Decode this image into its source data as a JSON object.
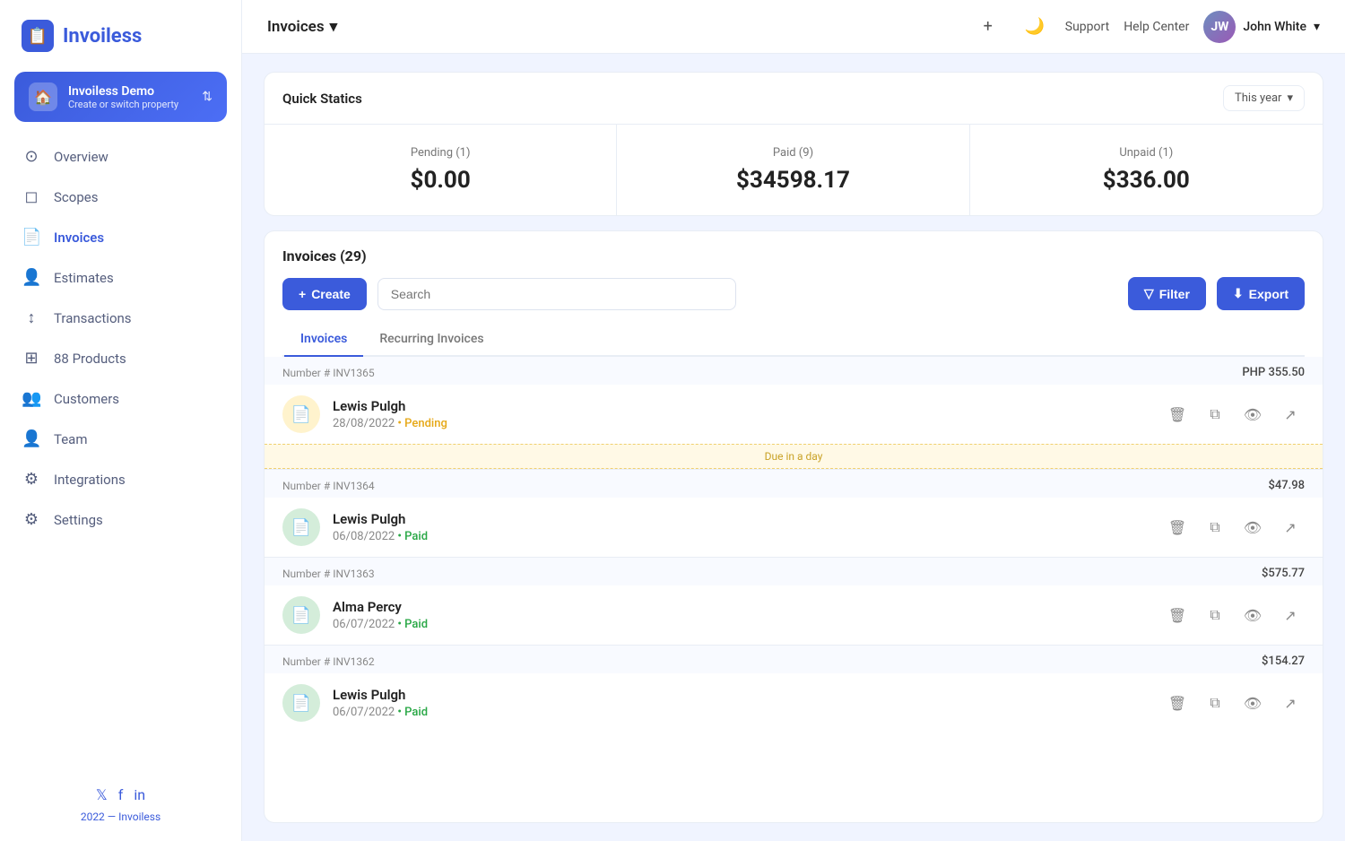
{
  "sidebar": {
    "logo_text": "Invoiless",
    "property": {
      "name": "Invoiless Demo",
      "sub": "Create or switch property",
      "icon": "🏠"
    },
    "nav_items": [
      {
        "id": "overview",
        "label": "Overview",
        "icon": "⊙"
      },
      {
        "id": "scopes",
        "label": "Scopes",
        "icon": "◻"
      },
      {
        "id": "invoices",
        "label": "Invoices",
        "icon": "📄"
      },
      {
        "id": "estimates",
        "label": "Estimates",
        "icon": "👤"
      },
      {
        "id": "transactions",
        "label": "Transactions",
        "icon": "↕"
      },
      {
        "id": "products",
        "label": "88 Products",
        "icon": "⊞"
      },
      {
        "id": "customers",
        "label": "Customers",
        "icon": "👥"
      },
      {
        "id": "team",
        "label": "Team",
        "icon": "👤"
      },
      {
        "id": "integrations",
        "label": "Integrations",
        "icon": "⚙"
      },
      {
        "id": "settings",
        "label": "Settings",
        "icon": "⚙"
      }
    ],
    "footer": {
      "social": [
        "𝕏",
        "f",
        "in"
      ],
      "text": "2022 — Invoiless"
    }
  },
  "topbar": {
    "title": "Invoices",
    "title_chevron": "▾",
    "add_icon": "+",
    "theme_icon": "🌙",
    "support_label": "Support",
    "help_label": "Help Center",
    "user_name": "John White",
    "user_chevron": "▾"
  },
  "quick_stats": {
    "title": "Quick Statics",
    "year_selector": "This year",
    "year_chevron": "▾",
    "stats": [
      {
        "label": "Pending (1)",
        "value": "$0.00"
      },
      {
        "label": "Paid (9)",
        "value": "$34598.17"
      },
      {
        "label": "Unpaid (1)",
        "value": "$336.00"
      }
    ]
  },
  "invoices_section": {
    "title": "Invoices (29)",
    "search_placeholder": "Search",
    "create_label": "+ Create",
    "filter_label": "Filter",
    "export_label": "Export",
    "tabs": [
      {
        "id": "invoices",
        "label": "Invoices",
        "active": true
      },
      {
        "id": "recurring",
        "label": "Recurring Invoices",
        "active": false
      }
    ],
    "invoices": [
      {
        "number": "Number # INV1365",
        "amount": "PHP 355.50",
        "name": "Lewis Pulgh",
        "date": "28/08/2022",
        "status": "Pending",
        "status_type": "pending",
        "due_notice": "Due in a day"
      },
      {
        "number": "Number # INV1364",
        "amount": "$47.98",
        "name": "Lewis Pulgh",
        "date": "06/08/2022",
        "status": "Paid",
        "status_type": "paid",
        "due_notice": null
      },
      {
        "number": "Number # INV1363",
        "amount": "$575.77",
        "name": "Alma Percy",
        "date": "06/07/2022",
        "status": "Paid",
        "status_type": "paid",
        "due_notice": null
      },
      {
        "number": "Number # INV1362",
        "amount": "$154.27",
        "name": "Lewis Pulgh",
        "date": "06/07/2022",
        "status": "Paid",
        "status_type": "paid",
        "due_notice": null
      }
    ]
  }
}
